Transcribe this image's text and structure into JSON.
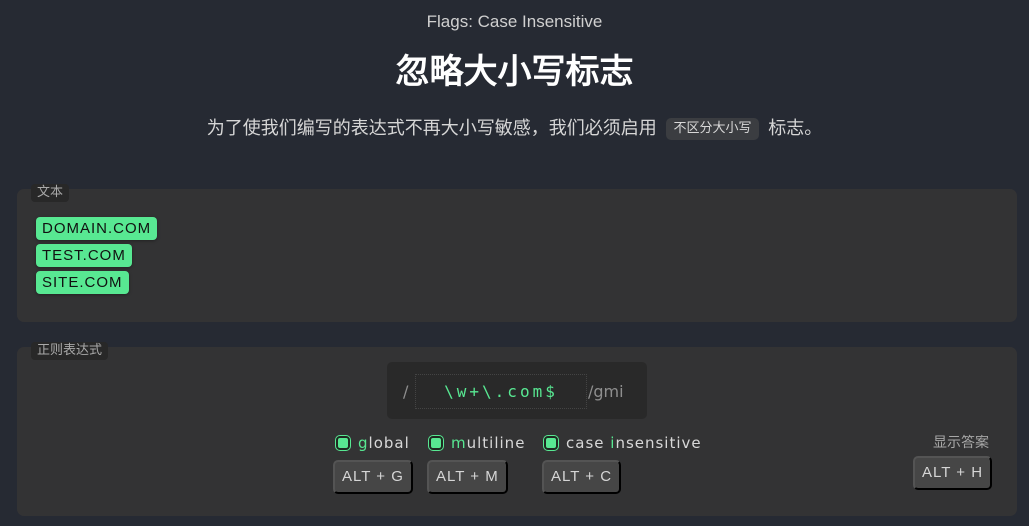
{
  "header": {
    "eyebrow": "Flags: Case Insensitive",
    "title": "忽略大小写标志",
    "subtitle_before": "为了使我们编写的表达式不再大小写敏感，我们必须启用",
    "subtitle_code": "不区分大小写",
    "subtitle_after": "标志。"
  },
  "text_panel": {
    "label": "文本",
    "matches": [
      "DOMAIN.COM",
      "TEST.COM",
      "SITE.COM"
    ]
  },
  "regex_panel": {
    "label": "正则表达式",
    "slash": "/",
    "pattern": "\\w+\\.com$",
    "flags": "/gmi",
    "options": [
      {
        "label_prefix": "g",
        "label_rest": "lobal",
        "shortcut": "ALT + G",
        "checked": true
      },
      {
        "label_prefix": "m",
        "label_rest": "ultiline",
        "shortcut": "ALT + M",
        "checked": true
      },
      {
        "label_prefix": "case ",
        "label_highlight": "i",
        "label_rest": "nsensitive",
        "shortcut": "ALT + C",
        "checked": true
      }
    ],
    "show_answer_label": "显示答案",
    "show_answer_shortcut": "ALT + H"
  },
  "colors": {
    "accent": "#58e892",
    "background": "#262a33",
    "panel": "#333334"
  }
}
